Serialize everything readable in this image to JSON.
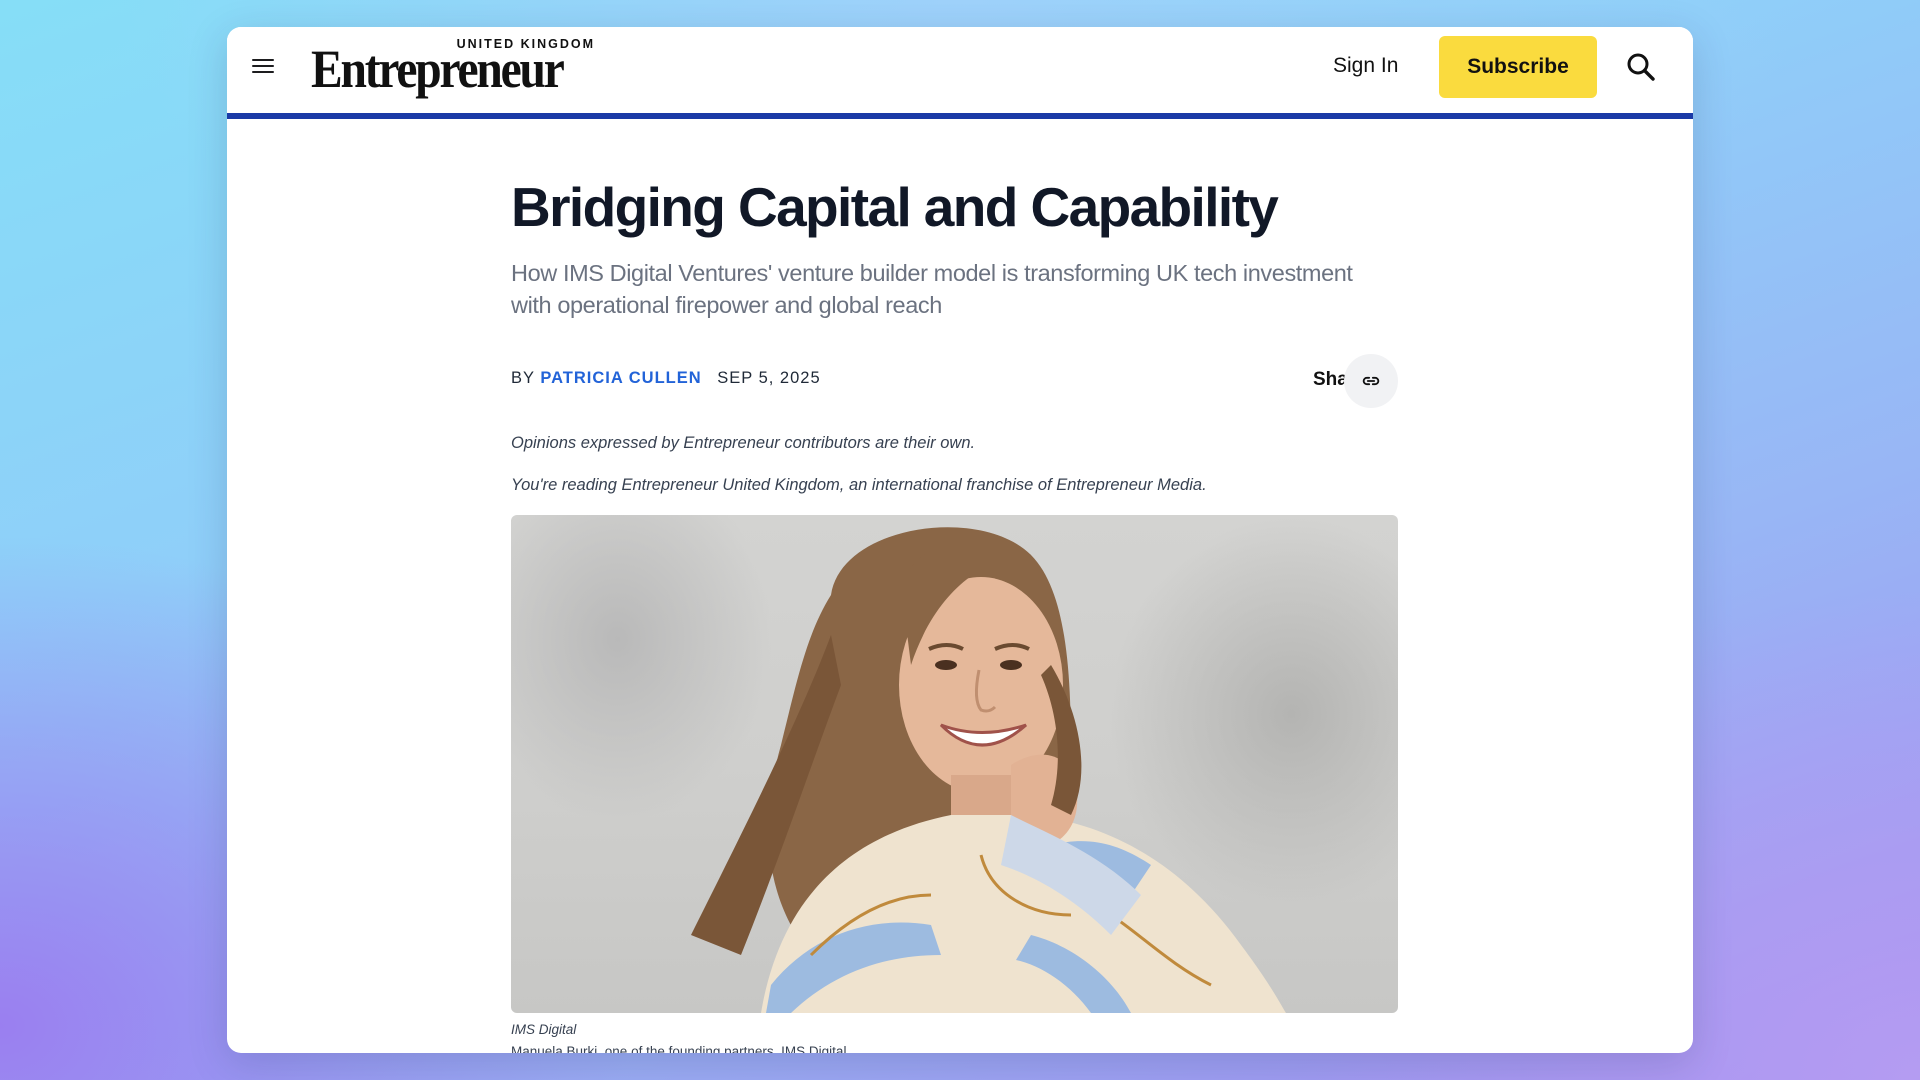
{
  "header": {
    "logo_edition": "UNITED KINGDOM",
    "logo_wordmark": "Entrepreneur",
    "signin_label": "Sign In",
    "subscribe_label": "Subscribe"
  },
  "article": {
    "title": "Bridging Capital and Capability",
    "subtitle": "How IMS Digital Ventures' venture builder model is transforming UK tech investment with operational firepower and global reach",
    "by_prefix": "BY",
    "author": "PATRICIA CULLEN",
    "date": "SEP 5, 2025",
    "share_label": "Share",
    "disclaimers": [
      "Opinions expressed by Entrepreneur contributors are their own.",
      "You're reading Entrepreneur United Kingdom, an international franchise of Entrepreneur Media."
    ],
    "image_credit": "IMS Digital",
    "image_caption": "Manuela Burki, one of the founding partners, IMS Digital"
  },
  "colors": {
    "header_rule": "#1a3aa6",
    "subscribe_bg": "#fadb3e",
    "author_link": "#2263d8"
  },
  "icons": {
    "menu": "hamburger-menu-icon",
    "search": "search-icon",
    "share": "link-icon"
  }
}
